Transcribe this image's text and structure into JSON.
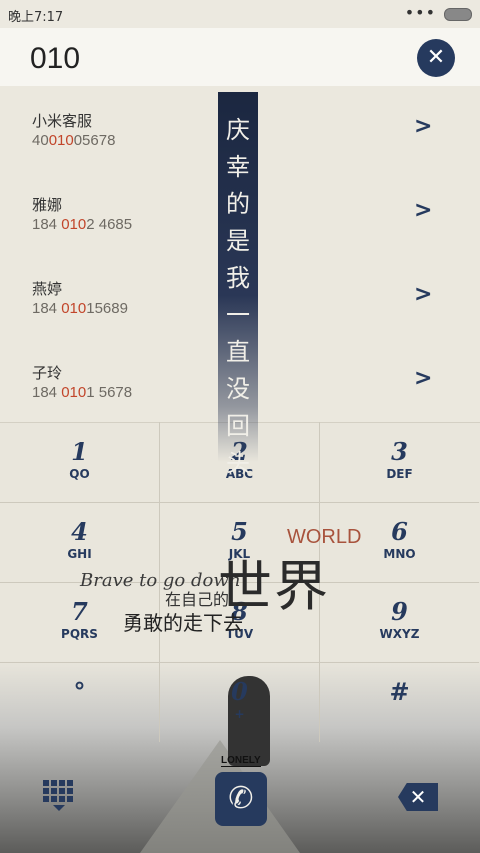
{
  "status_bar": {
    "time": "晚上7:17",
    "dots": "•••"
  },
  "search": {
    "query": "010",
    "clear_icon": "close-icon"
  },
  "results": [
    {
      "name": "小米客服",
      "number_pre": "40",
      "number_hl": "010",
      "number_post": "05678"
    },
    {
      "name": "雅娜",
      "number_pre": "184 ",
      "number_hl": "010",
      "number_post": "2 4685"
    },
    {
      "name": "燕婷",
      "number_pre": "184 ",
      "number_hl": "010",
      "number_post": "15689"
    },
    {
      "name": "子玲",
      "number_pre": "184 ",
      "number_hl": "010",
      "number_post": "1 5678"
    }
  ],
  "ribbon_text": [
    "庆",
    "幸",
    "的",
    "是",
    "我",
    "一",
    "直",
    "没",
    "回",
    "头"
  ],
  "keypad": [
    {
      "digit": "1",
      "letters": "QO"
    },
    {
      "digit": "2",
      "letters": "ABC"
    },
    {
      "digit": "3",
      "letters": "DEF"
    },
    {
      "digit": "4",
      "letters": "GHI"
    },
    {
      "digit": "5",
      "letters": "JKL"
    },
    {
      "digit": "6",
      "letters": "MNO"
    },
    {
      "digit": "7",
      "letters": "PQRS"
    },
    {
      "digit": "8",
      "letters": "TUV"
    },
    {
      "digit": "9",
      "letters": "WXYZ"
    },
    {
      "digit": "°",
      "letters": ""
    },
    {
      "digit": "0",
      "letters": "+"
    },
    {
      "digit": "#",
      "letters": ""
    }
  ],
  "artwork": {
    "brave": "Brave to go down",
    "world": "WORLD",
    "shijie": "世界",
    "zaizijide": "在自己的",
    "yonggan": "勇敢的走下去",
    "lonely": "LONELY"
  },
  "bottom_bar": {
    "call_symbol": "✆",
    "delete_symbol": "✕"
  },
  "colors": {
    "accent": "#263a5e",
    "highlight": "#c2452a",
    "background": "#e9e6dc"
  }
}
